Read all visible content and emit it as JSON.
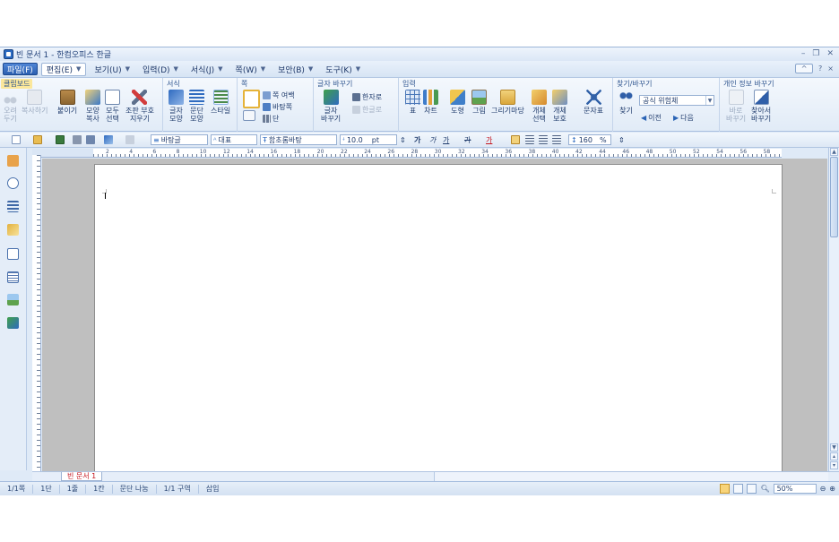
{
  "window": {
    "title": "빈 문서 1 - 한컴오피스 한글",
    "controls": [
      "–",
      "❐",
      "✕"
    ]
  },
  "menubar": {
    "file": "파일(F)",
    "items": [
      {
        "label": "편집(E)",
        "active": true
      },
      {
        "label": "보기(U)"
      },
      {
        "label": "입력(D)"
      },
      {
        "label": "서식(J)"
      },
      {
        "label": "쪽(W)"
      },
      {
        "label": "보안(B)"
      },
      {
        "label": "도구(K)"
      }
    ],
    "right": {
      "collapse": "^",
      "help": "?",
      "close": "×"
    }
  },
  "ribbon": {
    "clipboard": {
      "title": "클립보드",
      "cut": "오려\n두기",
      "copy": "복사하기",
      "paste": "붙이기",
      "shape_copy": "모양\n복사",
      "select_all": "모두\n선택",
      "erase": "조판 부호\n지우기"
    },
    "format": {
      "title": "서식",
      "char_shape": "글자\n모양",
      "para_shape": "문단\n모양",
      "style": "스타일"
    },
    "page": {
      "title": "쪽",
      "margin": "쪽 여백",
      "background": "바탕쪽",
      "columns": "단"
    },
    "convert": {
      "title": "글자 바꾸기",
      "convert": "글자\n바꾸기",
      "hanja": "한자로",
      "hangul": "한글로"
    },
    "insert": {
      "title": "입력",
      "table": "표",
      "chart": "차트",
      "shape": "도형",
      "picture": "그림",
      "drawing": "그리기마당",
      "obj_select": "개체\n선택",
      "obj_protect": "개체\n보호",
      "symbol": "문자표"
    },
    "find": {
      "title": "찾기/바꾸기",
      "find": "찾기",
      "mode": "공식 위험체",
      "prev": "이전",
      "next": "다음"
    },
    "privacy": {
      "title": "개인 정보 바꾸기",
      "replace": "바로\n바꾸기",
      "find_replace": "찾아서\n바꾸기"
    }
  },
  "formatbar": {
    "style": "바탕글",
    "lang": "대표",
    "font": "함초롬바탕",
    "size": "10.0",
    "unit": "pt",
    "bold": "가",
    "italic": "가",
    "underline": "가",
    "strike": "가",
    "color": "가",
    "line_spacing": "160",
    "percent": "%"
  },
  "ruler": {
    "labels": [
      "2",
      "4",
      "6",
      "8",
      "10",
      "12",
      "14",
      "16",
      "18",
      "20",
      "22",
      "24",
      "26",
      "28",
      "30",
      "32",
      "34",
      "36",
      "38",
      "40",
      "42",
      "44",
      "46",
      "48",
      "50",
      "52",
      "54",
      "56",
      "58"
    ]
  },
  "tabs": {
    "doc": "빈 문서 1"
  },
  "statusbar": {
    "page": "1/1쪽",
    "column": "1단",
    "line": "1줄",
    "col": "1칸",
    "break": "문단 나눔",
    "section": "1/1 구역",
    "mode": "삽입",
    "zoom": "50%"
  },
  "colors": {
    "accent": "#2b5fb0",
    "tab_text": "#c4121b",
    "ribbon_bg": "#e1ebf7"
  }
}
